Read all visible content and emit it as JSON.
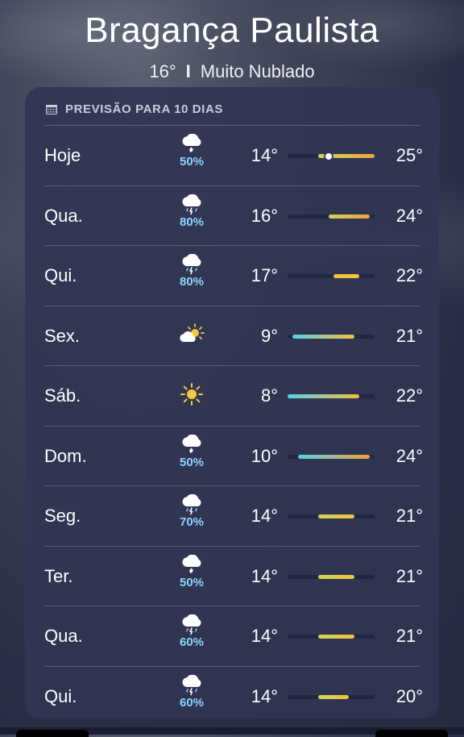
{
  "header": {
    "city": "Bragança Paulista",
    "current_temp": "16°",
    "separator": "I",
    "condition": "Muito Nublado"
  },
  "forecast": {
    "title": "PREVISÃO PARA 10 DIAS",
    "icon": "calendar-icon",
    "range_min": 8,
    "range_max": 25,
    "days": [
      {
        "day": "Hoje",
        "icon": "cloud-drizzle-icon",
        "precip": "50%",
        "low": "14°",
        "high": "25°",
        "lo": 14,
        "hi": 25,
        "current": 16
      },
      {
        "day": "Qua.",
        "icon": "cloud-thunderstorm-icon",
        "precip": "80%",
        "low": "16°",
        "high": "24°",
        "lo": 16,
        "hi": 24
      },
      {
        "day": "Qui.",
        "icon": "cloud-thunderstorm-icon",
        "precip": "80%",
        "low": "17°",
        "high": "22°",
        "lo": 17,
        "hi": 22
      },
      {
        "day": "Sex.",
        "icon": "partly-cloudy-sun-icon",
        "precip": "",
        "low": "9°",
        "high": "21°",
        "lo": 9,
        "hi": 21
      },
      {
        "day": "Sáb.",
        "icon": "sun-icon",
        "precip": "",
        "low": "8°",
        "high": "22°",
        "lo": 8,
        "hi": 22
      },
      {
        "day": "Dom.",
        "icon": "cloud-drizzle-icon",
        "precip": "50%",
        "low": "10°",
        "high": "24°",
        "lo": 10,
        "hi": 24
      },
      {
        "day": "Seg.",
        "icon": "cloud-thunderstorm-icon",
        "precip": "70%",
        "low": "14°",
        "high": "21°",
        "lo": 14,
        "hi": 21
      },
      {
        "day": "Ter.",
        "icon": "cloud-drizzle-icon",
        "precip": "50%",
        "low": "14°",
        "high": "21°",
        "lo": 14,
        "hi": 21
      },
      {
        "day": "Qua.",
        "icon": "cloud-thunderstorm-icon",
        "precip": "60%",
        "low": "14°",
        "high": "21°",
        "lo": 14,
        "hi": 21
      },
      {
        "day": "Qui.",
        "icon": "cloud-thunderstorm-icon",
        "precip": "60%",
        "low": "14°",
        "high": "20°",
        "lo": 14,
        "hi": 20
      }
    ]
  },
  "colors": {
    "card_bg": "#303552",
    "precip_text": "#8fd3ff",
    "cool": "#5ad0e6",
    "mild": "#c9d65a",
    "warm": "#f2c13d",
    "hot": "#f0a040"
  }
}
